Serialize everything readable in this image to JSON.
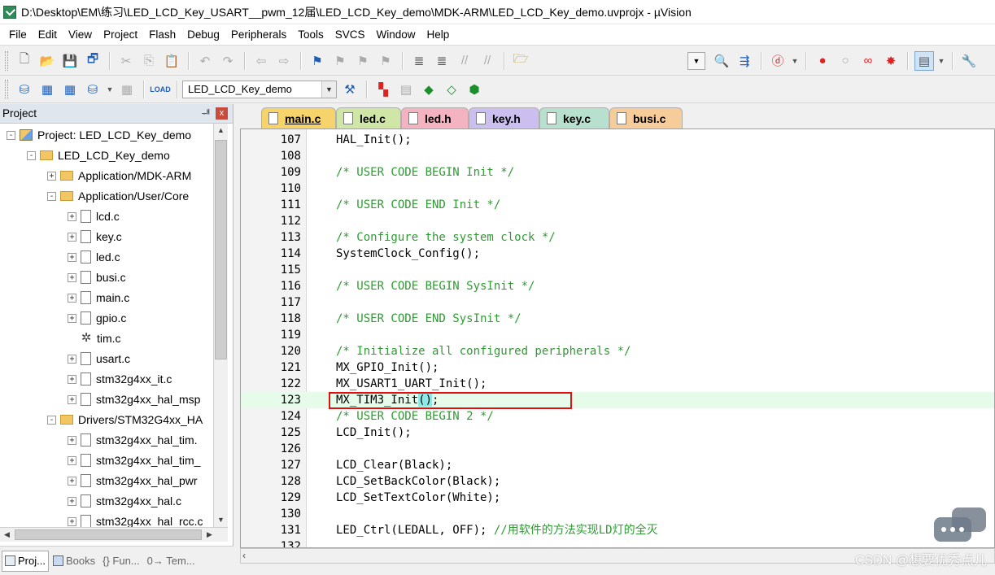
{
  "window": {
    "title": "D:\\Desktop\\EM\\练习\\LED_LCD_Key_USART__pwm_12届\\LED_LCD_Key_demo\\MDK-ARM\\LED_LCD_Key_demo.uvprojx - µVision"
  },
  "menu": [
    "File",
    "Edit",
    "View",
    "Project",
    "Flash",
    "Debug",
    "Peripherals",
    "Tools",
    "SVCS",
    "Window",
    "Help"
  ],
  "toolbar": {
    "target_name": "LED_LCD_Key_demo"
  },
  "project_panel": {
    "title": "Project",
    "pin_glyph": "ᆊ",
    "close_glyph": "x",
    "tree": [
      {
        "label": "Project: LED_LCD_Key_demo",
        "level": 0,
        "icon": "project",
        "expander": "-"
      },
      {
        "label": "LED_LCD_Key_demo",
        "level": 1,
        "icon": "target-folder",
        "expander": "-"
      },
      {
        "label": "Application/MDK-ARM",
        "level": 2,
        "icon": "folder",
        "expander": "+"
      },
      {
        "label": "Application/User/Core",
        "level": 2,
        "icon": "folder",
        "expander": "-"
      },
      {
        "label": "lcd.c",
        "level": 3,
        "icon": "file",
        "expander": "+"
      },
      {
        "label": "key.c",
        "level": 3,
        "icon": "file",
        "expander": "+"
      },
      {
        "label": "led.c",
        "level": 3,
        "icon": "file",
        "expander": "+"
      },
      {
        "label": "busi.c",
        "level": 3,
        "icon": "file",
        "expander": "+"
      },
      {
        "label": "main.c",
        "level": 3,
        "icon": "file",
        "expander": "+"
      },
      {
        "label": "gpio.c",
        "level": 3,
        "icon": "file",
        "expander": "+"
      },
      {
        "label": "tim.c",
        "level": 3,
        "icon": "gear-file",
        "expander": ""
      },
      {
        "label": "usart.c",
        "level": 3,
        "icon": "file",
        "expander": "+"
      },
      {
        "label": "stm32g4xx_it.c",
        "level": 3,
        "icon": "file",
        "expander": "+"
      },
      {
        "label": "stm32g4xx_hal_msp",
        "level": 3,
        "icon": "file",
        "expander": "+"
      },
      {
        "label": "Drivers/STM32G4xx_HA",
        "level": 2,
        "icon": "folder",
        "expander": "-"
      },
      {
        "label": "stm32g4xx_hal_tim.",
        "level": 3,
        "icon": "file",
        "expander": "+"
      },
      {
        "label": "stm32g4xx_hal_tim_",
        "level": 3,
        "icon": "file",
        "expander": "+"
      },
      {
        "label": "stm32g4xx_hal_pwr",
        "level": 3,
        "icon": "file",
        "expander": "+"
      },
      {
        "label": "stm32g4xx_hal.c",
        "level": 3,
        "icon": "file",
        "expander": "+"
      },
      {
        "label": "stm32g4xx_hal_rcc.c",
        "level": 3,
        "icon": "file",
        "expander": "+"
      }
    ],
    "bottom_tabs": [
      "Proj...",
      "Books",
      "{} Fun...",
      "0→ Tem..."
    ]
  },
  "editor": {
    "tabs": [
      {
        "label": "main.c",
        "color": "#f7d36b",
        "active": true
      },
      {
        "label": "led.c",
        "color": "#cfe6a6"
      },
      {
        "label": "led.h",
        "color": "#f3b3c0"
      },
      {
        "label": "key.h",
        "color": "#cbbff0"
      },
      {
        "label": "key.c",
        "color": "#b7e0cf"
      },
      {
        "label": "busi.c",
        "color": "#f6cc9b"
      }
    ],
    "lines": [
      {
        "num": "107",
        "text": "HAL_Init();"
      },
      {
        "num": "108",
        "text": ""
      },
      {
        "num": "109",
        "text": "/* USER CODE BEGIN Init */",
        "comment": true
      },
      {
        "num": "110",
        "text": ""
      },
      {
        "num": "111",
        "text": "/* USER CODE END Init */",
        "comment": true
      },
      {
        "num": "112",
        "text": ""
      },
      {
        "num": "113",
        "text": "/* Configure the system clock */",
        "comment": true
      },
      {
        "num": "114",
        "text": "SystemClock_Config();"
      },
      {
        "num": "115",
        "text": ""
      },
      {
        "num": "116",
        "text": "/* USER CODE BEGIN SysInit */",
        "comment": true
      },
      {
        "num": "117",
        "text": ""
      },
      {
        "num": "118",
        "text": "/* USER CODE END SysInit */",
        "comment": true
      },
      {
        "num": "119",
        "text": ""
      },
      {
        "num": "120",
        "text": "/* Initialize all configured peripherals */",
        "comment": true
      },
      {
        "num": "121",
        "text": "MX_GPIO_Init();"
      },
      {
        "num": "122",
        "text": "MX_USART1_UART_Init();"
      },
      {
        "num": "123",
        "text": "MX_TIM3_Init();",
        "highlight": true
      },
      {
        "num": "124",
        "text": "/* USER CODE BEGIN 2 */",
        "comment": true
      },
      {
        "num": "125",
        "text": "LCD_Init();"
      },
      {
        "num": "126",
        "text": ""
      },
      {
        "num": "127",
        "text": "LCD_Clear(Black);"
      },
      {
        "num": "128",
        "text": "LCD_SetBackColor(Black);"
      },
      {
        "num": "129",
        "text": "LCD_SetTextColor(White);"
      },
      {
        "num": "130",
        "text": ""
      },
      {
        "num": "131",
        "text": "LED_Ctrl(LEDALL, OFF); ",
        "trailing_comment": "//用软件的方法实现LD灯的全灭"
      },
      {
        "num": "132",
        "text": ""
      }
    ]
  },
  "watermark": "CSDN @想要优秀点儿",
  "colors": {
    "comment": "#2e9b33",
    "highlight_line": "#e6fbe9",
    "annotation_box": "#e01010"
  }
}
